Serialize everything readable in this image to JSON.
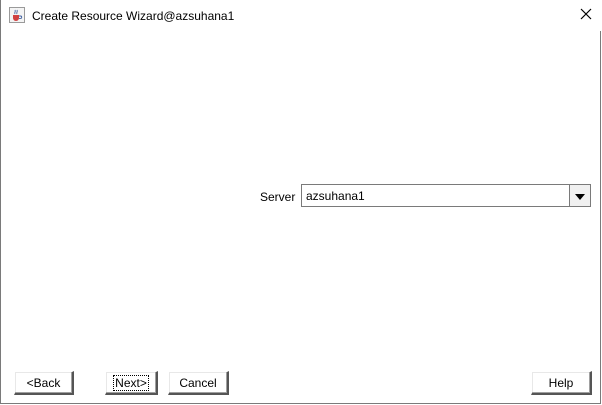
{
  "window": {
    "title": "Create Resource Wizard@azsuhana1",
    "icon": "java-cup-icon",
    "close_icon": "close-icon"
  },
  "form": {
    "server_label": "Server",
    "server_value": "azsuhana1",
    "dropdown_icon": "chevron-down-icon"
  },
  "buttons": {
    "back": "<Back",
    "next": "Next>",
    "cancel": "Cancel",
    "help": "Help"
  }
}
